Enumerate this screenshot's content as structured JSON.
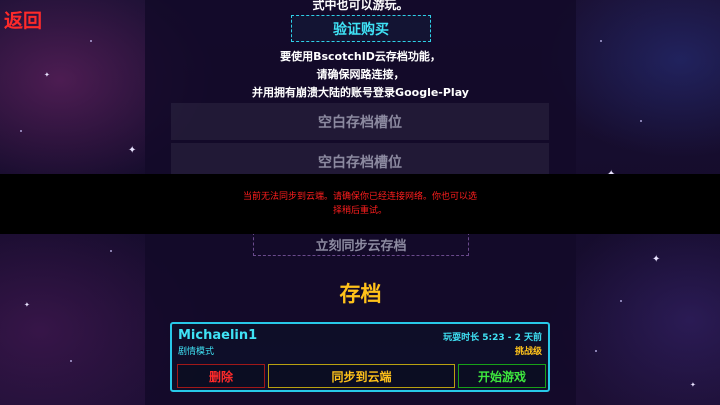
{
  "nav": {
    "back_label": "返回"
  },
  "cloud": {
    "intro_tail": "式中也可以游玩。",
    "verify_button": "验证购买",
    "notice_lines": [
      "要使用BscotchID云存档功能，",
      "请确保网路连接，",
      "并用拥有崩溃大陆的账号登录Google-Play"
    ],
    "slots": [
      "空白存档槽位",
      "空白存档槽位"
    ],
    "sync_now_button": "立刻同步云存档"
  },
  "toast": {
    "message": "当前无法同步到云端。请确保你已经连接网络。你也可以选择稍后重试。"
  },
  "saves": {
    "heading": "存档",
    "items": [
      {
        "name": "Michaelin1",
        "mode": "剧情模式",
        "meta": "玩耍时长 5:23 - 2 天前",
        "difficulty": "挑战级",
        "delete_label": "删除",
        "sync_label": "同步到云端",
        "start_label": "开始游戏"
      }
    ]
  },
  "colors": {
    "accent_cyan": "#3fe2f5",
    "accent_gold": "#ffc21a",
    "danger_red": "#ff2a2a",
    "go_green": "#3ee83e"
  }
}
